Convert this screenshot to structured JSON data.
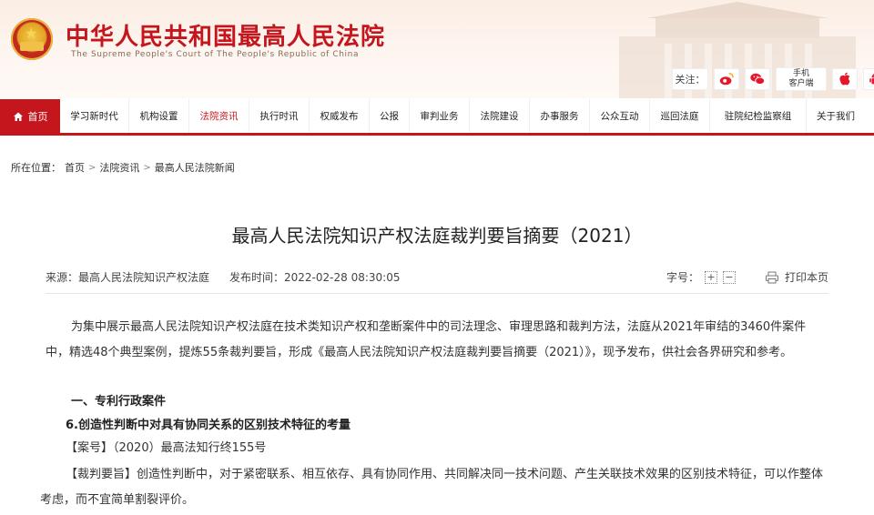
{
  "header": {
    "title": "中华人民共和国最高人民法院",
    "subtitle": "The Supreme People's Court of The People's Republic of China",
    "follow_label": "关注：",
    "mobile_client": [
      "手机",
      "客户端"
    ]
  },
  "nav": {
    "items": [
      {
        "label": "首页"
      },
      {
        "label": "学习新时代"
      },
      {
        "label": "机构设置"
      },
      {
        "label": "法院资讯"
      },
      {
        "label": "执行时讯"
      },
      {
        "label": "权威发布"
      },
      {
        "label": "公报"
      },
      {
        "label": "审判业务"
      },
      {
        "label": "法院建设"
      },
      {
        "label": "办事服务"
      },
      {
        "label": "公众互动"
      },
      {
        "label": "巡回法庭"
      },
      {
        "label": "驻院纪检监察组"
      },
      {
        "label": "关于我们"
      }
    ]
  },
  "breadcrumb": {
    "prefix": "所在位置：",
    "items": [
      "首页",
      "法院资讯",
      "最高人民法院新闻"
    ],
    "separator": ">"
  },
  "article": {
    "title": "最高人民法院知识产权法庭裁判要旨摘要（2021）",
    "source": "来源：最高人民法院知识产权法庭",
    "published": "发布时间：2022-02-28 08:30:05",
    "font_size_label": "字号：",
    "font_plus": "+",
    "font_minus": "−",
    "print_label": "打印本页",
    "p1": "为集中展示最高人民法院知识产权法庭在技术类知识产权和垄断案件中的司法理念、审理思路和裁判方法，法庭从2021年审结的3460件案件中，精选48个典型案例，提炼55条裁判要旨，形成《最高人民法院知识产权法庭裁判要旨摘要（2021）》，现予发布，供社会各界研究和参考。",
    "h1": "一、专利行政案件",
    "h2": "6.创造性判断中对具有协同关系的区别技术特征的考量",
    "case_no": "【案号】（2020）最高法知行终155号",
    "gist": "【裁判要旨】创造性判断中，对于紧密联系、相互依存、具有协同作用、共同解决同一技术问题、产生关联技术效果的区别技术特征，可以作整体考虑，而不宜简单割裂评价。"
  },
  "colors": {
    "brand_red": "#c4161c"
  }
}
